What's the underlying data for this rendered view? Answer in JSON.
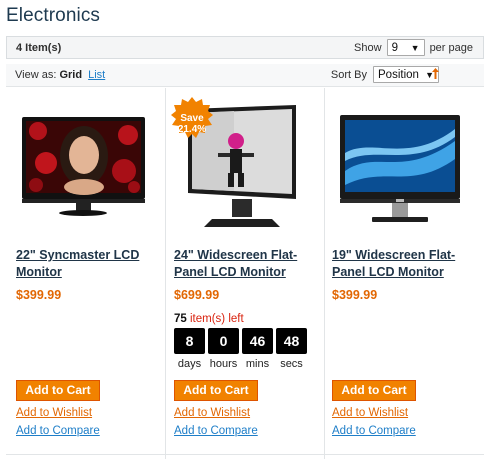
{
  "page": {
    "title": "Electronics"
  },
  "toolbar": {
    "item_count": "4 Item(s)",
    "show_label": "Show",
    "show_value": "9",
    "per_page_label": "per page",
    "view_as_label": "View as:",
    "view_grid": "Grid",
    "view_list": "List",
    "sort_by_label": "Sort By",
    "sort_value": "Position",
    "sort_dir_icon": "arrow-up-icon"
  },
  "products": [
    {
      "name_line1": "22\" Syncmaster LCD",
      "name_line2": "Monitor",
      "price": "$399.99",
      "add_to_cart": "Add to Cart",
      "add_to_wishlist": "Add to Wishlist",
      "add_to_compare": "Add to Compare"
    },
    {
      "name_line1": "24\" Widescreen Flat-",
      "name_line2": "Panel LCD Monitor",
      "price": "$699.99",
      "badge_line1": "Save",
      "badge_line2": "21.4%",
      "stock_count": "75",
      "stock_text": "item(s)",
      "stock_left": "left",
      "timer": {
        "days": "8",
        "hours": "0",
        "mins": "46",
        "secs": "48"
      },
      "timer_labels": {
        "days": "days",
        "hours": "hours",
        "mins": "mins",
        "secs": "secs"
      },
      "add_to_cart": "Add to Cart",
      "add_to_wishlist": "Add to Wishlist",
      "add_to_compare": "Add to Compare"
    },
    {
      "name_line1": "19\" Widescreen Flat-",
      "name_line2": "Panel LCD Monitor",
      "price": "$399.99",
      "add_to_cart": "Add to Cart",
      "add_to_wishlist": "Add to Wishlist",
      "add_to_compare": "Add to Compare"
    }
  ],
  "colors": {
    "price": "#e26703",
    "button": "#f18200",
    "link": "#1e7ec8",
    "badge": "#f18200"
  }
}
